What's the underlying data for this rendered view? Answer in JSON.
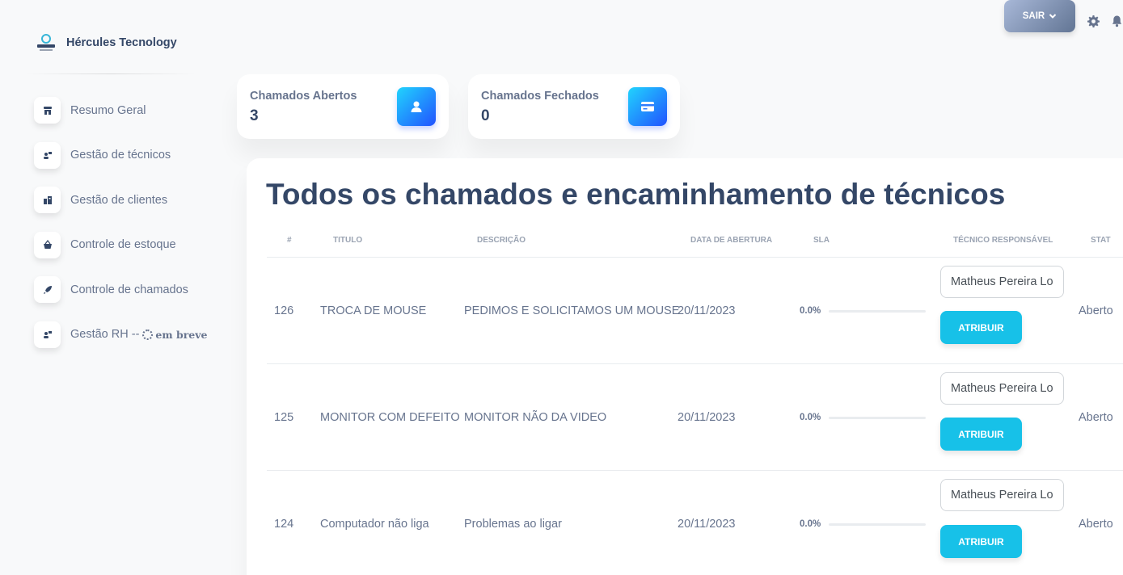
{
  "brand": {
    "name": "Hércules Tecnology"
  },
  "sidebar": {
    "items": [
      {
        "label": "Resumo Geral",
        "icon": "store-icon"
      },
      {
        "label": "Gestão de técnicos",
        "icon": "users-icon"
      },
      {
        "label": "Gestão de clientes",
        "icon": "building-icon"
      },
      {
        "label": "Controle de estoque",
        "icon": "basket-icon"
      },
      {
        "label": "Controle de chamados",
        "icon": "rocket-icon"
      },
      {
        "label": "Gestão RH --",
        "icon": "users-icon",
        "soon": "em breve"
      }
    ]
  },
  "topbar": {
    "logout_label": "SAIR"
  },
  "stats": [
    {
      "label": "Chamados Abertos",
      "value": "3",
      "icon": "user-icon"
    },
    {
      "label": "Chamados Fechados",
      "value": "0",
      "icon": "credit-card-icon"
    }
  ],
  "main": {
    "title": "Todos os chamados e encaminhamento de técnicos",
    "columns": [
      "#",
      "TITULO",
      "DESCRIÇÃO",
      "DATA DE ABERTURA",
      "SLA",
      "TÉCNICO RESPONSÁVEL",
      "STAT"
    ],
    "rows": [
      {
        "id": "126",
        "title": "TROCA DE MOUSE",
        "description": "PEDIMOS E SOLICITAMOS UM MOUSE",
        "date": "20/11/2023",
        "sla": "0.0%",
        "sla_fraction": 0.0,
        "tecnico": "Matheus Pereira Lo",
        "action": "ATRIBUIR",
        "status": "Aberto"
      },
      {
        "id": "125",
        "title": "MONITOR COM DEFEITO",
        "description": "MONITOR NÃO DA VIDEO",
        "date": "20/11/2023",
        "sla": "0.0%",
        "sla_fraction": 0.0,
        "tecnico": "Matheus Pereira Lo",
        "action": "ATRIBUIR",
        "status": "Aberto"
      },
      {
        "id": "124",
        "title": "Computador não liga",
        "description": "Problemas ao ligar",
        "date": "20/11/2023",
        "sla": "0.0%",
        "sla_fraction": 0.0,
        "tecnico": "Matheus Pereira Lo",
        "action": "ATRIBUIR",
        "status": "Aberto"
      }
    ]
  },
  "colors": {
    "accent": "#17c1e8",
    "heading": "#344767",
    "text": "#67748e"
  }
}
